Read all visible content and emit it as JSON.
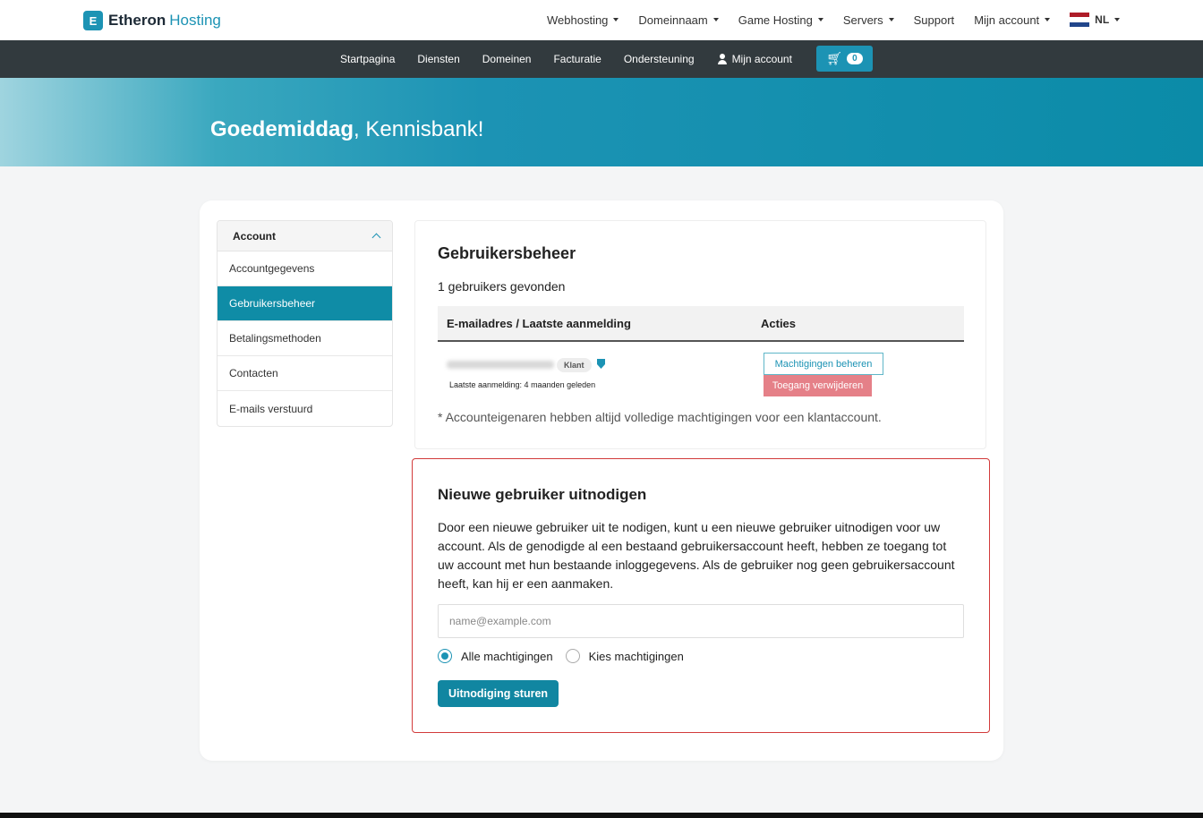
{
  "brand": {
    "mark": "E",
    "name_bold": "Etheron",
    "name_light": "Hosting",
    "color": "#1c93b4"
  },
  "topnav": {
    "items": [
      "Webhosting",
      "Domeinnaam",
      "Game Hosting",
      "Servers",
      "Support",
      "Mijn account"
    ],
    "language": "NL"
  },
  "subnav": {
    "items": [
      "Startpagina",
      "Diensten",
      "Domeinen",
      "Facturatie",
      "Ondersteuning",
      "Mijn account"
    ],
    "cart_count": "0"
  },
  "hero": {
    "greeting": "Goedemiddag",
    "name": ", Kennisbank!"
  },
  "sidebar": {
    "header": "Account",
    "items": [
      "Accountgegevens",
      "Gebruikersbeheer",
      "Betalingsmethoden",
      "Contacten",
      "E-mails verstuurd"
    ],
    "active": "Gebruikersbeheer"
  },
  "users": {
    "title": "Gebruikersbeheer",
    "count_text": "1 gebruikers gevonden",
    "columns": [
      "E-mailadres / Laatste aanmelding",
      "Acties"
    ],
    "rows": [
      {
        "badge": "Klant",
        "last_login": "Laatste aanmelding: 4 maanden geleden",
        "manage_label": "Machtigingen beheren",
        "remove_label": "Toegang verwijderen"
      }
    ],
    "note": "* Accounteigenaren hebben altijd volledige machtigingen voor een klantaccount."
  },
  "invite": {
    "title": "Nieuwe gebruiker uitnodigen",
    "description": "Door een nieuwe gebruiker uit te nodigen, kunt u een nieuwe gebruiker uitnodigen voor uw account. Als de genodigde al een bestaand gebruikersaccount heeft, hebben ze toegang tot uw account met hun bestaande inloggegevens. Als de gebruiker nog geen gebruikersaccount heeft, kan hij er een aanmaken.",
    "email_placeholder": "name@example.com",
    "email_value": "",
    "option_all": "Alle machtigingen",
    "option_choose": "Kies machtigingen",
    "selected_option": "Alle machtigingen",
    "submit_label": "Uitnodiging sturen"
  }
}
